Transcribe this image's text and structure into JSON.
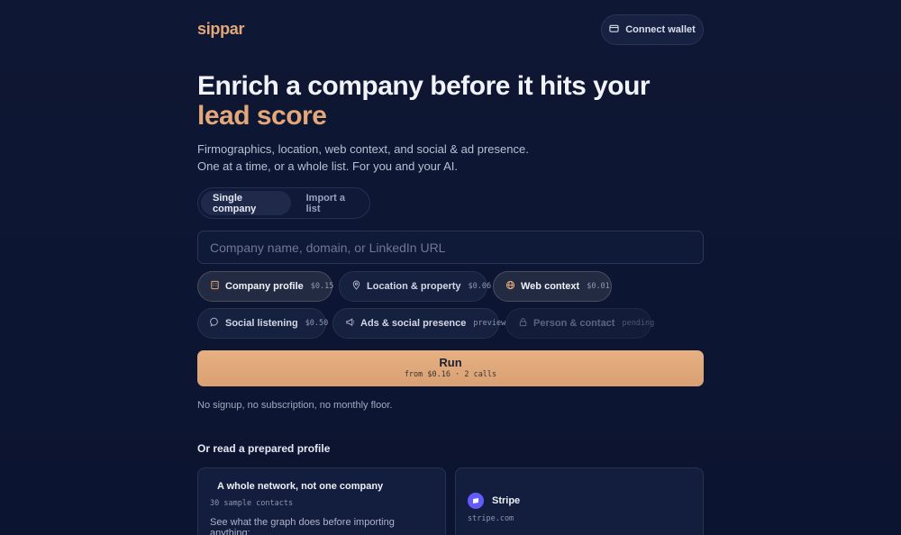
{
  "brand": "sippar",
  "header": {
    "wallet_label": "Connect wallet"
  },
  "hero": {
    "title": "Enrich a company before it hits your",
    "title_accent": "lead score",
    "subtitle": "Firmographics, location, web context, and social & ad presence. One at a time, or a whole list. For you and your AI."
  },
  "mode_tabs": [
    {
      "label": "Single company",
      "active": true
    },
    {
      "label": "Import a list",
      "active": false
    }
  ],
  "search": {
    "placeholder": "Company name, domain, or LinkedIn URL",
    "value": ""
  },
  "chips": [
    {
      "label": "Company profile",
      "price": "$0.15",
      "icon": "building-icon",
      "selected": true
    },
    {
      "label": "Location & property",
      "price": "$0.06",
      "icon": "pin-icon",
      "selected": false
    },
    {
      "label": "Web context",
      "price": "$0.01",
      "icon": "globe-icon",
      "selected": true
    },
    {
      "label": "Social listening",
      "price": "$0.50",
      "icon": "chat-icon",
      "selected": false
    },
    {
      "label": "Ads & social presence",
      "price": "preview",
      "icon": "megaphone-icon",
      "selected": false
    },
    {
      "label": "Person & contact",
      "price": "pending",
      "icon": "lock-icon",
      "disabled": true
    }
  ],
  "run": {
    "label": "Run",
    "meta": "from $0.16 · 2 calls"
  },
  "note": "No signup, no subscription, no monthly floor.",
  "prepared": {
    "heading": "Or read a prepared profile",
    "cards": [
      {
        "title": "A whole network, not one company",
        "subtitle": "30 sample contacts",
        "desc": "See what the graph does before importing anything:"
      },
      {
        "title": "Stripe",
        "subtitle": "stripe.com",
        "logo": "stripe-logo-icon"
      }
    ]
  },
  "colors": {
    "accent": "#e3a77a",
    "background": "#0d1530",
    "stripe": "#635bff"
  }
}
